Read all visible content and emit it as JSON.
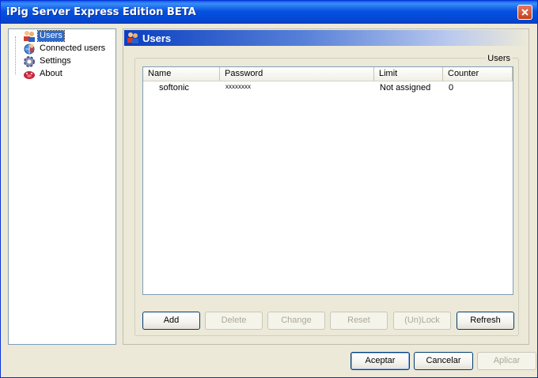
{
  "window": {
    "title": "iPig Server Express Edition BETA",
    "close_icon": "close-icon",
    "accent": "#0a5ce7"
  },
  "tree": {
    "items": [
      {
        "label": "Users",
        "icon": "users-icon",
        "selected": true
      },
      {
        "label": "Connected users",
        "icon": "connected-users-icon",
        "selected": false
      },
      {
        "label": "Settings",
        "icon": "settings-gear-icon",
        "selected": false
      },
      {
        "label": "About",
        "icon": "pig-icon",
        "selected": false
      }
    ]
  },
  "panel": {
    "title": "Users",
    "icon": "users-icon",
    "group_label": "Users"
  },
  "table": {
    "columns": [
      "Name",
      "Password",
      "Limit",
      "Counter"
    ],
    "rows": [
      {
        "name": "softonic",
        "password": "xxxxxxxx",
        "limit": "Not assigned",
        "counter": "0"
      }
    ]
  },
  "actions": {
    "add": "Add",
    "delete": "Delete",
    "change": "Change",
    "reset": "Reset",
    "unlock": "(Un)Lock",
    "refresh": "Refresh"
  },
  "dialog": {
    "ok": "Aceptar",
    "cancel": "Cancelar",
    "apply": "Aplicar"
  }
}
